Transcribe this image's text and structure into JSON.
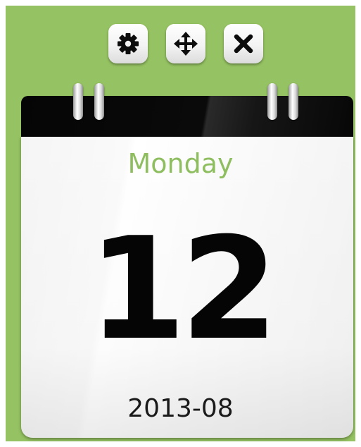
{
  "widget": {
    "background_color": "#95c262",
    "accent_color": "#8ebe60"
  },
  "toolbar": {
    "buttons": [
      {
        "name": "settings",
        "icon": "gear-icon"
      },
      {
        "name": "move",
        "icon": "move-arrows-icon"
      },
      {
        "name": "close",
        "icon": "close-icon"
      }
    ]
  },
  "calendar": {
    "weekday": "Monday",
    "day": "12",
    "year_month": "2013-08"
  }
}
